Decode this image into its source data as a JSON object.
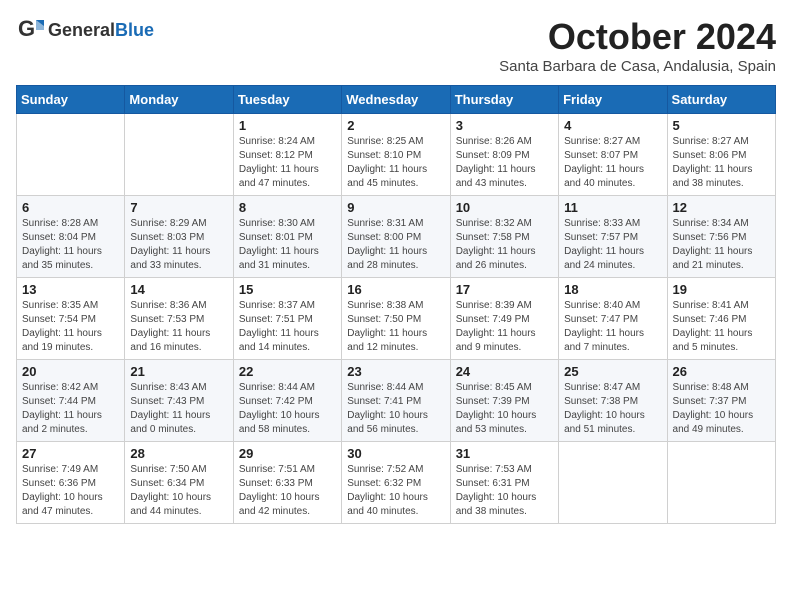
{
  "header": {
    "logo_general": "General",
    "logo_blue": "Blue",
    "month_title": "October 2024",
    "subtitle": "Santa Barbara de Casa, Andalusia, Spain"
  },
  "weekdays": [
    "Sunday",
    "Monday",
    "Tuesday",
    "Wednesday",
    "Thursday",
    "Friday",
    "Saturday"
  ],
  "weeks": [
    [
      {
        "day": "",
        "info": ""
      },
      {
        "day": "",
        "info": ""
      },
      {
        "day": "1",
        "info": "Sunrise: 8:24 AM\nSunset: 8:12 PM\nDaylight: 11 hours and 47 minutes."
      },
      {
        "day": "2",
        "info": "Sunrise: 8:25 AM\nSunset: 8:10 PM\nDaylight: 11 hours and 45 minutes."
      },
      {
        "day": "3",
        "info": "Sunrise: 8:26 AM\nSunset: 8:09 PM\nDaylight: 11 hours and 43 minutes."
      },
      {
        "day": "4",
        "info": "Sunrise: 8:27 AM\nSunset: 8:07 PM\nDaylight: 11 hours and 40 minutes."
      },
      {
        "day": "5",
        "info": "Sunrise: 8:27 AM\nSunset: 8:06 PM\nDaylight: 11 hours and 38 minutes."
      }
    ],
    [
      {
        "day": "6",
        "info": "Sunrise: 8:28 AM\nSunset: 8:04 PM\nDaylight: 11 hours and 35 minutes."
      },
      {
        "day": "7",
        "info": "Sunrise: 8:29 AM\nSunset: 8:03 PM\nDaylight: 11 hours and 33 minutes."
      },
      {
        "day": "8",
        "info": "Sunrise: 8:30 AM\nSunset: 8:01 PM\nDaylight: 11 hours and 31 minutes."
      },
      {
        "day": "9",
        "info": "Sunrise: 8:31 AM\nSunset: 8:00 PM\nDaylight: 11 hours and 28 minutes."
      },
      {
        "day": "10",
        "info": "Sunrise: 8:32 AM\nSunset: 7:58 PM\nDaylight: 11 hours and 26 minutes."
      },
      {
        "day": "11",
        "info": "Sunrise: 8:33 AM\nSunset: 7:57 PM\nDaylight: 11 hours and 24 minutes."
      },
      {
        "day": "12",
        "info": "Sunrise: 8:34 AM\nSunset: 7:56 PM\nDaylight: 11 hours and 21 minutes."
      }
    ],
    [
      {
        "day": "13",
        "info": "Sunrise: 8:35 AM\nSunset: 7:54 PM\nDaylight: 11 hours and 19 minutes."
      },
      {
        "day": "14",
        "info": "Sunrise: 8:36 AM\nSunset: 7:53 PM\nDaylight: 11 hours and 16 minutes."
      },
      {
        "day": "15",
        "info": "Sunrise: 8:37 AM\nSunset: 7:51 PM\nDaylight: 11 hours and 14 minutes."
      },
      {
        "day": "16",
        "info": "Sunrise: 8:38 AM\nSunset: 7:50 PM\nDaylight: 11 hours and 12 minutes."
      },
      {
        "day": "17",
        "info": "Sunrise: 8:39 AM\nSunset: 7:49 PM\nDaylight: 11 hours and 9 minutes."
      },
      {
        "day": "18",
        "info": "Sunrise: 8:40 AM\nSunset: 7:47 PM\nDaylight: 11 hours and 7 minutes."
      },
      {
        "day": "19",
        "info": "Sunrise: 8:41 AM\nSunset: 7:46 PM\nDaylight: 11 hours and 5 minutes."
      }
    ],
    [
      {
        "day": "20",
        "info": "Sunrise: 8:42 AM\nSunset: 7:44 PM\nDaylight: 11 hours and 2 minutes."
      },
      {
        "day": "21",
        "info": "Sunrise: 8:43 AM\nSunset: 7:43 PM\nDaylight: 11 hours and 0 minutes."
      },
      {
        "day": "22",
        "info": "Sunrise: 8:44 AM\nSunset: 7:42 PM\nDaylight: 10 hours and 58 minutes."
      },
      {
        "day": "23",
        "info": "Sunrise: 8:44 AM\nSunset: 7:41 PM\nDaylight: 10 hours and 56 minutes."
      },
      {
        "day": "24",
        "info": "Sunrise: 8:45 AM\nSunset: 7:39 PM\nDaylight: 10 hours and 53 minutes."
      },
      {
        "day": "25",
        "info": "Sunrise: 8:47 AM\nSunset: 7:38 PM\nDaylight: 10 hours and 51 minutes."
      },
      {
        "day": "26",
        "info": "Sunrise: 8:48 AM\nSunset: 7:37 PM\nDaylight: 10 hours and 49 minutes."
      }
    ],
    [
      {
        "day": "27",
        "info": "Sunrise: 7:49 AM\nSunset: 6:36 PM\nDaylight: 10 hours and 47 minutes."
      },
      {
        "day": "28",
        "info": "Sunrise: 7:50 AM\nSunset: 6:34 PM\nDaylight: 10 hours and 44 minutes."
      },
      {
        "day": "29",
        "info": "Sunrise: 7:51 AM\nSunset: 6:33 PM\nDaylight: 10 hours and 42 minutes."
      },
      {
        "day": "30",
        "info": "Sunrise: 7:52 AM\nSunset: 6:32 PM\nDaylight: 10 hours and 40 minutes."
      },
      {
        "day": "31",
        "info": "Sunrise: 7:53 AM\nSunset: 6:31 PM\nDaylight: 10 hours and 38 minutes."
      },
      {
        "day": "",
        "info": ""
      },
      {
        "day": "",
        "info": ""
      }
    ]
  ]
}
